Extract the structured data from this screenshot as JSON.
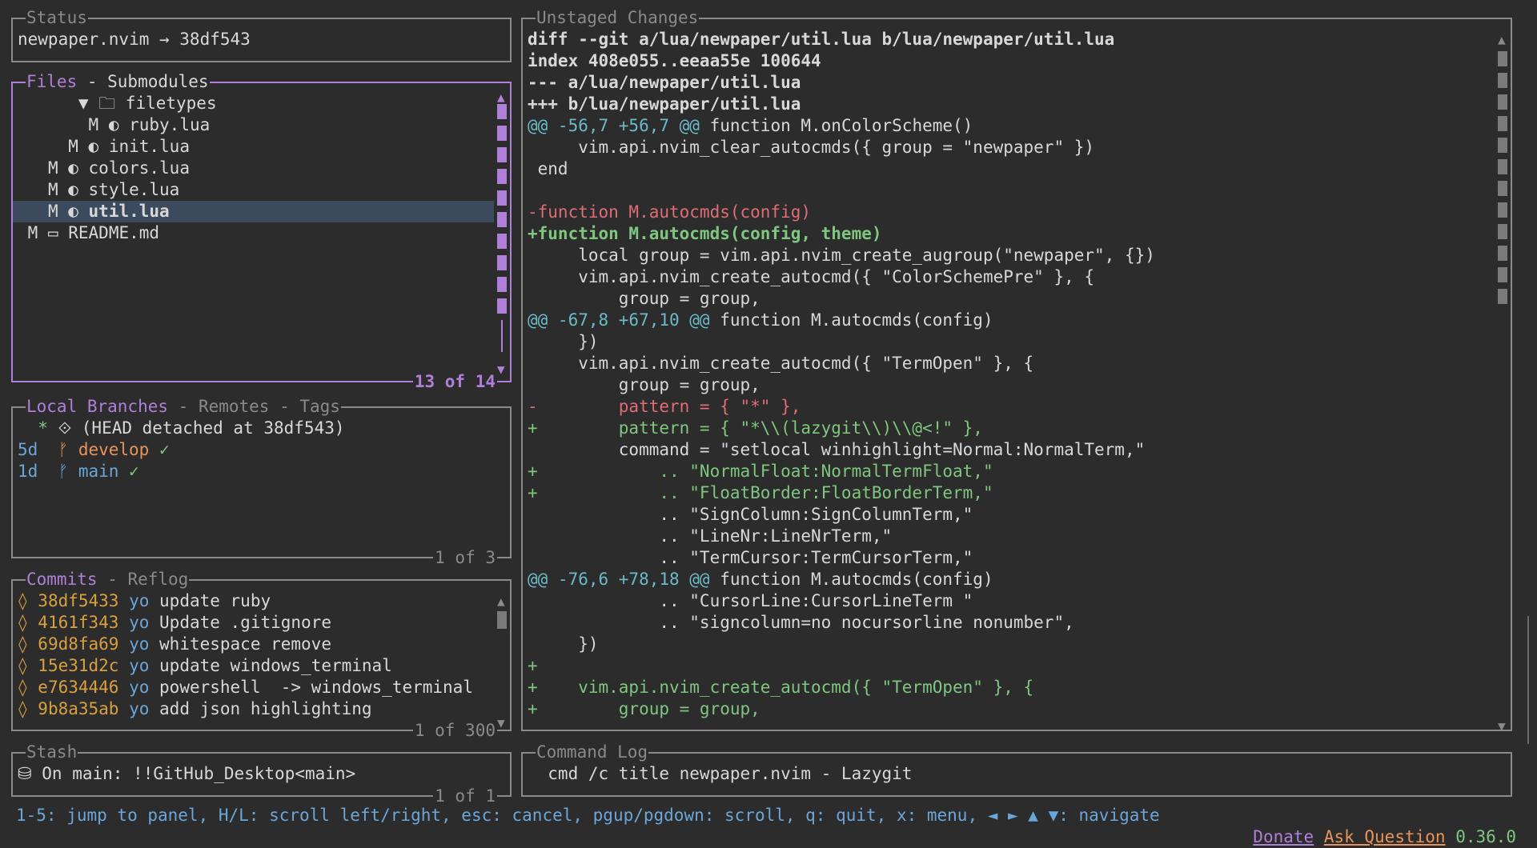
{
  "status": {
    "title": "Status",
    "text": "newpaper.nvim → 38df543"
  },
  "files": {
    "title_active": "Files",
    "title_rest": " - Submodules",
    "footer": "13 of 14",
    "items": [
      {
        "indent": "      ",
        "status": "",
        "icon": "▼ 🗀",
        "name": "filetypes"
      },
      {
        "indent": "         ",
        "status": "M",
        "icon": "◐",
        "name": "ruby.lua"
      },
      {
        "indent": "       ",
        "status": "M",
        "icon": "◐",
        "name": "init.lua"
      },
      {
        "indent": "     ",
        "status": "M",
        "icon": "◐",
        "name": "colors.lua"
      },
      {
        "indent": "     ",
        "status": "M",
        "icon": "◐",
        "name": "style.lua"
      },
      {
        "indent": "     ",
        "status": "M",
        "icon": "◐",
        "name": "util.lua"
      },
      {
        "indent": "   ",
        "status": "M",
        "icon": "▭",
        "name": "README.md"
      }
    ]
  },
  "branches": {
    "title_active": "Local Branches",
    "title_rest": " - Remotes - Tags",
    "footer": "1 of 3",
    "items": [
      {
        "age": "",
        "marker": "  *",
        "icon": "⟐",
        "name": "(HEAD detached at 38df543)",
        "check": ""
      },
      {
        "age": "5d",
        "marker": "",
        "icon": "ᚠ",
        "name": "develop",
        "check": "✓"
      },
      {
        "age": "1d",
        "marker": "",
        "icon": "ᚠ",
        "name": "main",
        "check": "✓"
      }
    ]
  },
  "commits": {
    "title_active": "Commits",
    "title_rest": " - Reflog",
    "footer": "1 of 300",
    "items": [
      {
        "hash": "38df5433",
        "author": "yo",
        "msg": "update ruby"
      },
      {
        "hash": "4161f343",
        "author": "yo",
        "msg": "Update .gitignore"
      },
      {
        "hash": "69d8fa69",
        "author": "yo",
        "msg": "whitespace remove"
      },
      {
        "hash": "15e31d2c",
        "author": "yo",
        "msg": "update windows_terminal"
      },
      {
        "hash": "e7634446",
        "author": "yo",
        "msg": "powershell  -> windows_terminal"
      },
      {
        "hash": "9b8a35ab",
        "author": "yo",
        "msg": "add json highlighting"
      }
    ]
  },
  "stash": {
    "title": "Stash",
    "footer": "1 of 1",
    "text": "On main: !!GitHub_Desktop<main>"
  },
  "diff": {
    "title": "Unstaged Changes",
    "lines": [
      {
        "t": "header",
        "text": "diff --git a/lua/newpaper/util.lua b/lua/newpaper/util.lua"
      },
      {
        "t": "header",
        "text": "index 408e055..eeaa55e 100644"
      },
      {
        "t": "header",
        "text": "--- a/lua/newpaper/util.lua"
      },
      {
        "t": "header",
        "text": "+++ b/lua/newpaper/util.lua"
      },
      {
        "t": "hunk",
        "range": "@@ -56,7 +56,7 @@",
        "text": " function M.onColorScheme()"
      },
      {
        "t": "ctx",
        "text": "     vim.api.nvim_clear_autocmds({ group = \"newpaper\" })"
      },
      {
        "t": "ctx",
        "text": " end"
      },
      {
        "t": "ctx",
        "text": ""
      },
      {
        "t": "del",
        "text": "-function M.autocmds(config)"
      },
      {
        "t": "addb",
        "text": "+function M.autocmds(config, theme)"
      },
      {
        "t": "ctx",
        "text": "     local group = vim.api.nvim_create_augroup(\"newpaper\", {})"
      },
      {
        "t": "ctx",
        "text": "     vim.api.nvim_create_autocmd({ \"ColorSchemePre\" }, {"
      },
      {
        "t": "ctx",
        "text": "         group = group,"
      },
      {
        "t": "hunk",
        "range": "@@ -67,8 +67,10 @@",
        "text": " function M.autocmds(config)"
      },
      {
        "t": "ctx",
        "text": "     })"
      },
      {
        "t": "ctx",
        "text": "     vim.api.nvim_create_autocmd({ \"TermOpen\" }, {"
      },
      {
        "t": "ctx",
        "text": "         group = group,"
      },
      {
        "t": "del",
        "text": "-        pattern = { \"*\" },"
      },
      {
        "t": "add",
        "text": "+        pattern = { \"*\\\\(lazygit\\\\)\\\\@<!\" },"
      },
      {
        "t": "ctx",
        "text": "         command = \"setlocal winhighlight=Normal:NormalTerm,\""
      },
      {
        "t": "add",
        "text": "+            .. \"NormalFloat:NormalTermFloat,\""
      },
      {
        "t": "add",
        "text": "+            .. \"FloatBorder:FloatBorderTerm,\""
      },
      {
        "t": "ctx",
        "text": "             .. \"SignColumn:SignColumnTerm,\""
      },
      {
        "t": "ctx",
        "text": "             .. \"LineNr:LineNrTerm,\""
      },
      {
        "t": "ctx",
        "text": "             .. \"TermCursor:TermCursorTerm,\""
      },
      {
        "t": "hunk",
        "range": "@@ -76,6 +78,18 @@",
        "text": " function M.autocmds(config)"
      },
      {
        "t": "ctx",
        "text": "             .. \"CursorLine:CursorLineTerm \""
      },
      {
        "t": "ctx",
        "text": "             .. \"signcolumn=no nocursorline nonumber\","
      },
      {
        "t": "ctx",
        "text": "     })"
      },
      {
        "t": "add",
        "text": "+"
      },
      {
        "t": "add",
        "text": "+    vim.api.nvim_create_autocmd({ \"TermOpen\" }, {"
      },
      {
        "t": "add",
        "text": "+        group = group,"
      }
    ]
  },
  "command_log": {
    "title": "Command Log",
    "text": "  cmd /c title newpaper.nvim - Lazygit"
  },
  "footer": {
    "help": "1-5: jump to panel, H/L: scroll left/right, esc: cancel, pgup/pgdown: scroll, q: quit, x: menu, ◄ ► ▲ ▼: navigate",
    "donate": "Donate",
    "ask": "Ask Question",
    "version": "0.36.0"
  },
  "colors": {
    "accent": "#b07fd9",
    "border": "#8a8a8a",
    "selection": "#3b4a5c",
    "green": "#7fc77f",
    "red": "#e06c75",
    "hash": "#d9a040",
    "hunk": "#6bbac8"
  }
}
